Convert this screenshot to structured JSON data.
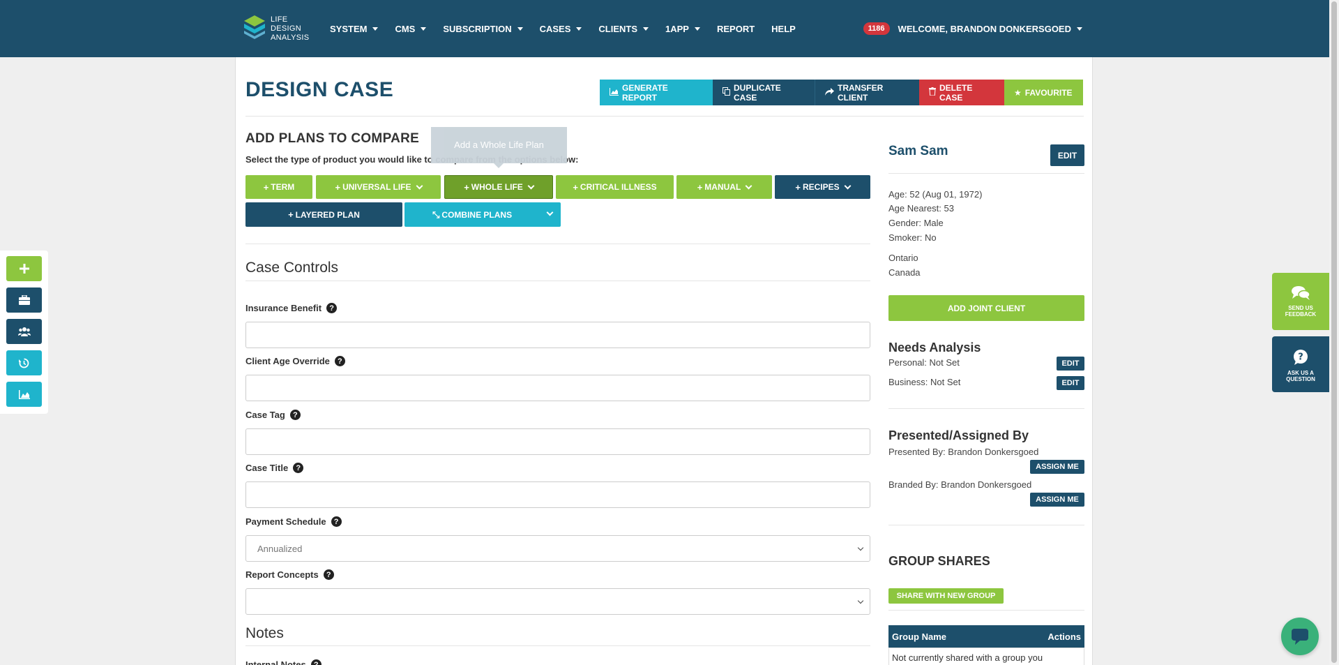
{
  "header": {
    "logo_lines": [
      "LIFE",
      "DESIGN",
      "ANALYSIS"
    ],
    "nav": [
      {
        "label": "SYSTEM",
        "dropdown": true
      },
      {
        "label": "CMS",
        "dropdown": true
      },
      {
        "label": "SUBSCRIPTION",
        "dropdown": true
      },
      {
        "label": "CASES",
        "dropdown": true
      },
      {
        "label": "CLIENTS",
        "dropdown": true
      },
      {
        "label": "1APP",
        "dropdown": true
      },
      {
        "label": "REPORT",
        "dropdown": false
      },
      {
        "label": "HELP",
        "dropdown": false
      }
    ],
    "notification_count": "1186",
    "welcome": "WELCOME, BRANDON DONKERSGOED"
  },
  "page": {
    "title": "DESIGN CASE",
    "actions": {
      "generate_report": "GENERATE REPORT",
      "duplicate_case": "DUPLICATE CASE",
      "transfer_client": "TRANSFER CLIENT",
      "delete_case": "DELETE CASE",
      "favourite": "FAVOURITE"
    },
    "colors": {
      "navy": "#1d4f6b",
      "green": "#8dc63f",
      "cyan": "#1fb4cc",
      "red": "#d3363c"
    }
  },
  "plans": {
    "heading": "ADD PLANS TO COMPARE",
    "subtitle": "Select the type of product you would like to compare from the options below:",
    "tooltip": "Add a Whole Life Plan",
    "buttons": {
      "term": "TERM",
      "universal_life": "UNIVERSAL LIFE",
      "whole_life": "WHOLE LIFE",
      "critical_illness": "CRITICAL ILLNESS",
      "manual": "MANUAL",
      "recipes": "RECIPES",
      "layered_plan": "LAYERED PLAN",
      "combine_plans": "COMBINE PLANS"
    }
  },
  "controls": {
    "heading": "Case Controls",
    "insurance_benefit": {
      "label": "Insurance Benefit",
      "value": ""
    },
    "client_age_override": {
      "label": "Client Age Override",
      "value": ""
    },
    "case_tag": {
      "label": "Case Tag",
      "value": ""
    },
    "case_title": {
      "label": "Case Title",
      "value": ""
    },
    "payment_schedule": {
      "label": "Payment Schedule",
      "value": "Annualized"
    },
    "report_concepts": {
      "label": "Report Concepts",
      "value": ""
    },
    "notes_heading": "Notes",
    "internal_notes": "Internal Notes"
  },
  "client": {
    "name": "Sam Sam",
    "edit": "EDIT",
    "age": "Age: 52 (Aug 01, 1972)",
    "age_nearest": "Age Nearest: 53",
    "gender": "Gender: Male",
    "smoker": "Smoker: No",
    "province": "Ontario",
    "country": "Canada",
    "add_joint": "ADD JOINT CLIENT"
  },
  "needs": {
    "heading": "Needs Analysis",
    "personal": "Personal: Not Set",
    "business": "Business: Not Set",
    "edit": "EDIT"
  },
  "presented": {
    "heading": "Presented/Assigned By",
    "presented_by": "Presented By: Brandon Donkersgoed",
    "branded_by": "Branded By: Brandon Donkersgoed",
    "assign_me": "ASSIGN ME"
  },
  "groups": {
    "heading": "GROUP SHARES",
    "share_btn": "SHARE WITH NEW GROUP",
    "col_name": "Group Name",
    "col_actions": "Actions",
    "empty": "Not currently shared with a group you"
  },
  "widgets": {
    "feedback": [
      "SEND US",
      "FEEDBACK"
    ],
    "question": [
      "ASK US A",
      "QUESTION"
    ]
  }
}
